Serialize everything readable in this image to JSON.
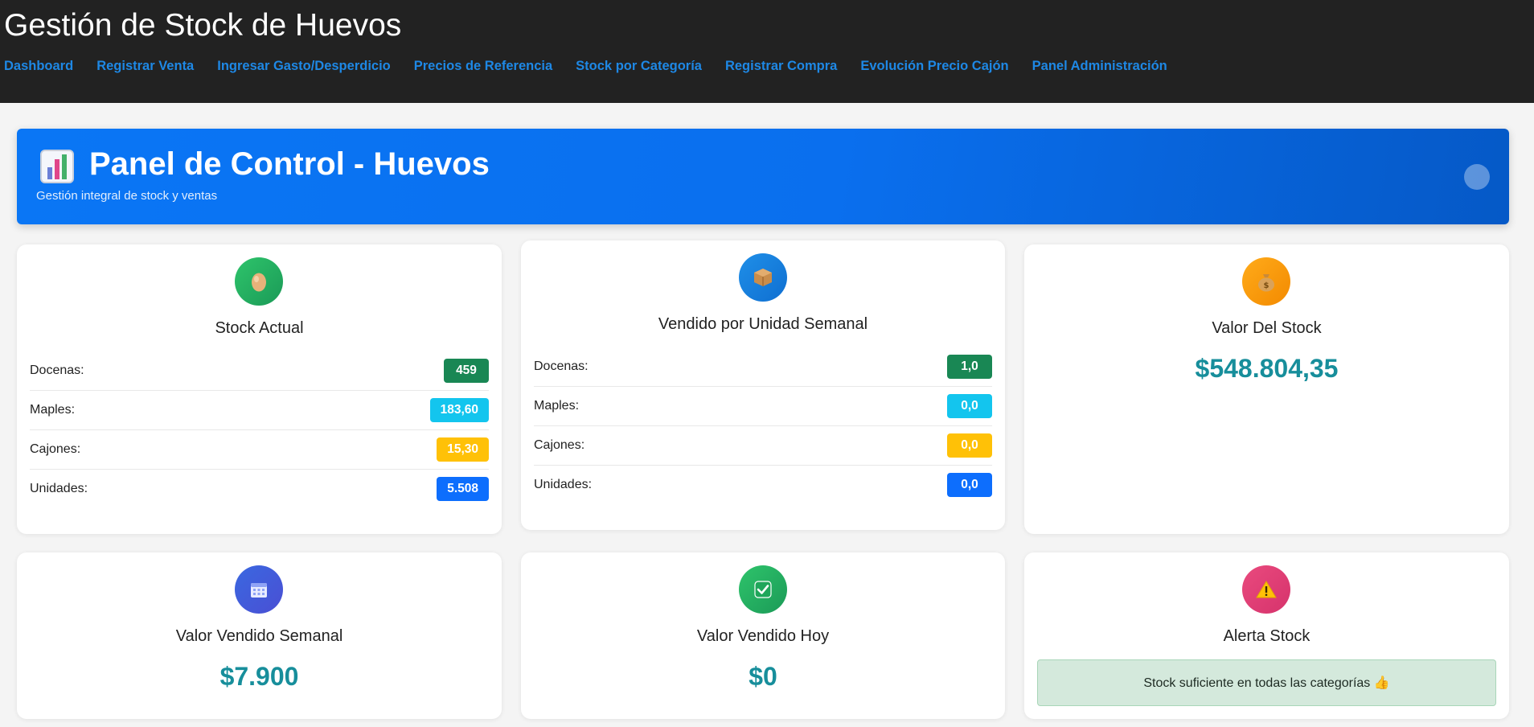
{
  "app": {
    "title": "Gestión de Stock de Huevos",
    "nav": [
      "Dashboard",
      "Registrar Venta",
      "Ingresar Gasto/Desperdicio",
      "Precios de Referencia",
      "Stock por Categoría",
      "Registrar Compra",
      "Evolución Precio Cajón",
      "Panel Administración"
    ]
  },
  "hero": {
    "title": "Panel de Control - Huevos",
    "subtitle": "Gestión integral de stock y ventas",
    "icon": "bar-chart-icon"
  },
  "cards": {
    "stock_actual": {
      "title": "Stock Actual",
      "icon": "egg-icon",
      "rows": [
        {
          "label": "Docenas:",
          "value": "459",
          "color": "#198754"
        },
        {
          "label": "Maples:",
          "value": "183,60",
          "color": "#0dcaf0"
        },
        {
          "label": "Cajones:",
          "value": "15,30",
          "color": "#ffc107"
        },
        {
          "label": "Unidades:",
          "value": "5.508",
          "color": "#0d6efd"
        }
      ]
    },
    "vendido_semanal": {
      "title": "Vendido por Unidad Semanal",
      "icon": "package-icon",
      "rows": [
        {
          "label": "Docenas:",
          "value": "1,0",
          "color": "#198754"
        },
        {
          "label": "Maples:",
          "value": "0,0",
          "color": "#0dcaf0"
        },
        {
          "label": "Cajones:",
          "value": "0,0",
          "color": "#ffc107"
        },
        {
          "label": "Unidades:",
          "value": "0,0",
          "color": "#0d6efd"
        }
      ]
    },
    "valor_stock": {
      "title": "Valor Del Stock",
      "icon": "money-bag-icon",
      "value": "$548.804,35"
    },
    "valor_vendido_semanal": {
      "title": "Valor Vendido Semanal",
      "icon": "calendar-icon",
      "value": "$7.900"
    },
    "valor_vendido_hoy": {
      "title": "Valor Vendido Hoy",
      "icon": "checkmark-icon",
      "value": "$0"
    },
    "alerta_stock": {
      "title": "Alerta Stock",
      "icon": "warning-icon",
      "message": "Stock suficiente en todas las categorías 👍"
    }
  }
}
